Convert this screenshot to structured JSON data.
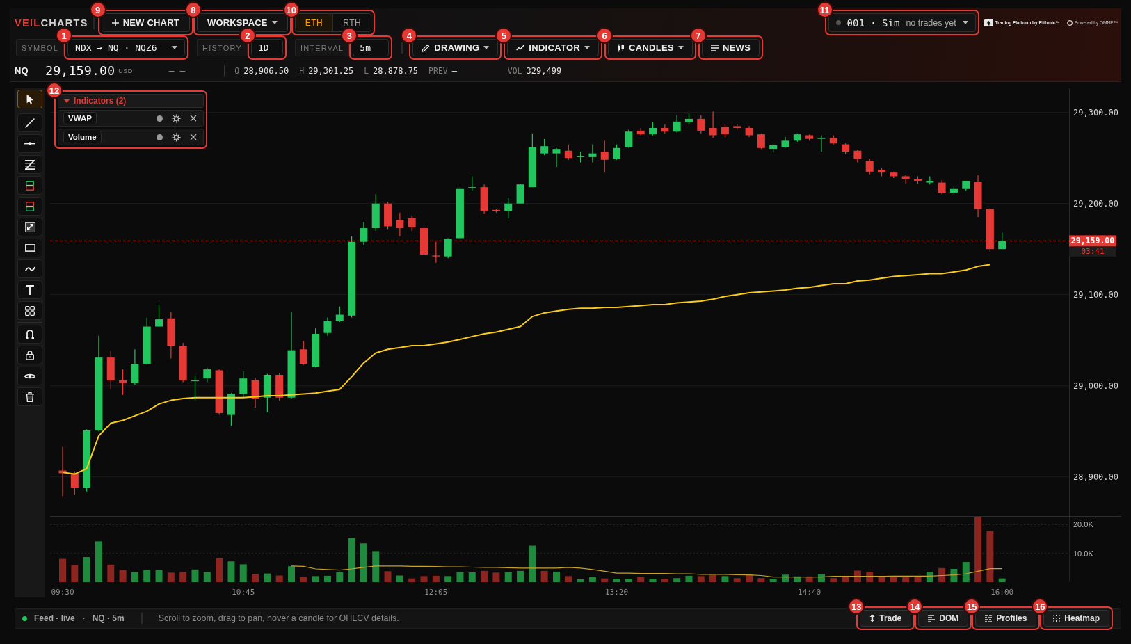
{
  "header": {
    "brand": {
      "accent": "VEIL",
      "text": "CHARTS"
    },
    "new_chart": {
      "label": "NEW CHART",
      "callout": "9"
    },
    "workspace": {
      "label": "WORKSPACE",
      "callout": "8"
    },
    "session": {
      "callout": "10",
      "options": [
        {
          "label": "ETH",
          "selected": true
        },
        {
          "label": "RTH",
          "selected": false
        }
      ]
    },
    "account": {
      "id": "001 · Sim",
      "note": "no trades yet",
      "callout": "11"
    },
    "credits": [
      {
        "kind": "arrow",
        "text": "Trading Platform by Rithmic™"
      },
      {
        "kind": "ring",
        "text": "Powered by OMNE™"
      }
    ]
  },
  "toolbar": {
    "symbol": {
      "label": "SYMBOL",
      "value": "NDX → NQ · NQZ6",
      "callout": "1"
    },
    "history": {
      "label": "HISTORY",
      "value": "1D",
      "callout": "2"
    },
    "interval": {
      "label": "INTERVAL",
      "value": "5m",
      "callout": "3"
    },
    "menus": [
      {
        "kind": "pencil",
        "label": "DRAWING",
        "dropdown": true,
        "callout": "4"
      },
      {
        "kind": "indicator",
        "label": "INDICATOR",
        "dropdown": true,
        "callout": "5"
      },
      {
        "kind": "candles",
        "label": "CANDLES",
        "dropdown": true,
        "callout": "6"
      },
      {
        "kind": "news",
        "label": "NEWS",
        "dropdown": false,
        "callout": "7"
      }
    ]
  },
  "quote": {
    "symbol": "NQ",
    "last": "29,159.00",
    "currency": "USD",
    "change": "– –",
    "stats": [
      {
        "label": "O",
        "value": "28,906.50"
      },
      {
        "label": "H",
        "value": "29,301.25"
      },
      {
        "label": "L",
        "value": "28,878.75"
      },
      {
        "label": "PREV",
        "value": "–"
      },
      {
        "label": "VOL",
        "value": "329,499"
      }
    ]
  },
  "tool_groups": [
    [
      {
        "kind": "select",
        "selected": true
      }
    ],
    [
      {
        "kind": "trendline",
        "selected": false
      },
      {
        "kind": "hline",
        "selected": false
      },
      {
        "kind": "channel",
        "selected": false
      },
      {
        "kind": "long",
        "selected": false
      },
      {
        "kind": "short",
        "selected": false
      },
      {
        "kind": "measure",
        "selected": false
      },
      {
        "kind": "rectangle",
        "selected": false
      },
      {
        "kind": "brush",
        "selected": false
      },
      {
        "kind": "text",
        "selected": false
      },
      {
        "kind": "pattern",
        "selected": false
      }
    ],
    [
      {
        "kind": "magnet",
        "selected": false
      },
      {
        "kind": "lock",
        "selected": false
      },
      {
        "kind": "eye",
        "selected": false
      },
      {
        "kind": "trash",
        "selected": false
      }
    ]
  ],
  "indicators_panel": {
    "title": "Indicators (2)",
    "expanded": true,
    "callout": "12",
    "items": [
      {
        "name": "VWAP"
      },
      {
        "name": "Volume"
      }
    ]
  },
  "price_chart": {
    "chart_data": {
      "type": "candlestick",
      "grid": true,
      "ylim": [
        28857,
        29326.5
      ],
      "yticks": [
        {
          "value": 28900,
          "label": "28,900.00"
        },
        {
          "value": 29000,
          "label": "29,000.00"
        },
        {
          "value": 29100,
          "label": "29,100.00"
        },
        {
          "value": 29200,
          "label": "29,200.00"
        },
        {
          "value": 29300,
          "label": "29,300.00"
        }
      ],
      "categories": [
        null,
        null,
        null,
        null,
        null,
        null,
        null,
        null,
        null,
        null,
        null,
        null,
        null,
        null,
        null,
        null,
        null,
        null,
        null,
        null,
        null,
        null,
        null,
        null,
        null,
        null,
        null,
        null,
        null,
        null,
        null,
        null,
        null,
        null,
        null,
        null,
        null,
        null,
        null,
        null,
        null,
        null,
        null,
        null,
        null,
        null,
        null,
        null,
        null,
        null,
        null,
        null,
        null,
        null,
        null,
        null,
        null,
        null,
        null,
        null,
        null,
        null,
        null,
        null,
        null,
        null,
        null,
        null,
        null,
        null,
        null,
        null,
        null,
        null,
        null,
        null,
        null,
        null,
        null
      ],
      "ohlc": [
        [
          28907,
          28933,
          28879,
          28904
        ],
        [
          28904,
          28906,
          28880,
          28888
        ],
        [
          28888,
          28952,
          28884,
          28951
        ],
        [
          28951,
          29055,
          28950,
          29031
        ],
        [
          29031,
          29038,
          28996,
          29006
        ],
        [
          29006,
          29018,
          28990,
          29003
        ],
        [
          29003,
          29040,
          29001,
          29024
        ],
        [
          29024,
          29075,
          29023,
          29065
        ],
        [
          29065,
          29089,
          29065,
          29073
        ],
        [
          29074,
          29081,
          29030,
          29044
        ],
        [
          29044,
          29047,
          29004,
          29006
        ],
        [
          29005,
          29011,
          28984,
          29006
        ],
        [
          29008,
          29020,
          29004,
          29018
        ],
        [
          29017,
          29018,
          28968,
          28970
        ],
        [
          28968,
          28992,
          28956,
          28991
        ],
        [
          28991,
          29016,
          28987,
          29008
        ],
        [
          29006,
          29009,
          28976,
          28986
        ],
        [
          28987,
          29013,
          28971,
          29012
        ],
        [
          29012,
          29014,
          28984,
          28987
        ],
        [
          28987,
          29081,
          28986,
          29039
        ],
        [
          29040,
          29049,
          29023,
          29024
        ],
        [
          29021,
          29063,
          29020,
          29057
        ],
        [
          29058,
          29075,
          29055,
          29071
        ],
        [
          29071,
          29087,
          29070,
          29078
        ],
        [
          29077,
          29164,
          29075,
          29158
        ],
        [
          29158,
          29180,
          29154,
          29173
        ],
        [
          29173,
          29210,
          29170,
          29200
        ],
        [
          29200,
          29202,
          29172,
          29175
        ],
        [
          29182,
          29190,
          29164,
          29173
        ],
        [
          29184,
          29187,
          29170,
          29174
        ],
        [
          29173,
          29174,
          29143,
          29144
        ],
        [
          29143,
          29158,
          29135,
          29142
        ],
        [
          29142,
          29162,
          29140,
          29161
        ],
        [
          29162,
          29218,
          29161,
          29216
        ],
        [
          29217,
          29230,
          29214,
          29218
        ],
        [
          29218,
          29221,
          29189,
          29192
        ],
        [
          29193,
          29194,
          29190,
          29192
        ],
        [
          29192,
          29206,
          29184,
          29200
        ],
        [
          29200,
          29222,
          29200,
          29221
        ],
        [
          29218,
          29277,
          29218,
          29262
        ],
        [
          29255,
          29271,
          29253,
          29263
        ],
        [
          29255,
          29261,
          29240,
          29260
        ],
        [
          29258,
          29265,
          29248,
          29250
        ],
        [
          29251,
          29257,
          29245,
          29252
        ],
        [
          29251,
          29265,
          29245,
          29255
        ],
        [
          29257,
          29269,
          29234,
          29248
        ],
        [
          29249,
          29265,
          29248,
          29261
        ],
        [
          29262,
          29281,
          29261,
          29279
        ],
        [
          29280,
          29283,
          29275,
          29276
        ],
        [
          29276,
          29289,
          29275,
          29283
        ],
        [
          29283,
          29287,
          29277,
          29279
        ],
        [
          29279,
          29297,
          29278,
          29290
        ],
        [
          29289,
          29299,
          29287,
          29293
        ],
        [
          29293,
          29297,
          29277,
          29280
        ],
        [
          29283,
          29301,
          29272,
          29275
        ],
        [
          29284,
          29287,
          29273,
          29276
        ],
        [
          29285,
          29287,
          29281,
          29283
        ],
        [
          29283,
          29285,
          29273,
          29275
        ],
        [
          29276,
          29277,
          29260,
          29261
        ],
        [
          29260,
          29265,
          29256,
          29264
        ],
        [
          29262,
          29273,
          29261,
          29269
        ],
        [
          29269,
          29277,
          29268,
          29276
        ],
        [
          29275,
          29276,
          29269,
          29271
        ],
        [
          29272,
          29275,
          29257,
          29272
        ],
        [
          29272,
          29275,
          29265,
          29266
        ],
        [
          29265,
          29266,
          29254,
          29257
        ],
        [
          29258,
          29259,
          29245,
          29249
        ],
        [
          29247,
          29249,
          29232,
          29235
        ],
        [
          29237,
          29239,
          29230,
          29234
        ],
        [
          29234,
          29235,
          29228,
          29230
        ],
        [
          29230,
          29231,
          29222,
          29227
        ],
        [
          29227,
          29230,
          29222,
          29225
        ],
        [
          29223,
          29230,
          29221,
          29225
        ],
        [
          29223,
          29226,
          29210,
          29212
        ],
        [
          29212,
          29219,
          29210,
          29216
        ],
        [
          29216,
          29225,
          29214,
          29225
        ],
        [
          29224,
          29231,
          29185,
          29194
        ],
        [
          29194,
          29195,
          29147,
          29150
        ],
        [
          29150,
          29168,
          29150,
          29159
        ]
      ],
      "series": [
        {
          "type": "line",
          "color": "#facc15",
          "values": [
            28905,
            28903,
            28909,
            28945,
            28959,
            28962,
            28967,
            28972,
            28980,
            28984,
            28986,
            28987,
            28987,
            28987,
            28987,
            28987,
            28988,
            28989,
            28989,
            28990,
            28991,
            28992,
            28994,
            28996,
            29010,
            29025,
            29036,
            29040,
            29042,
            29044,
            29044,
            29046,
            29048,
            29051,
            29054,
            29057,
            29059,
            29062,
            29065,
            29076,
            29080,
            29082,
            29084,
            29085,
            29085,
            29086,
            29086,
            29087,
            29088,
            29089,
            29089,
            29091,
            29092,
            29093,
            29095,
            29098,
            29100,
            29102,
            29103,
            29104,
            29105,
            29107,
            29108,
            29110,
            29112,
            29112,
            29115,
            29116,
            29118,
            29120,
            29121,
            29122,
            29123,
            29123,
            29125,
            29127,
            29131,
            29133,
            null
          ]
        }
      ],
      "ref_lines": [
        {
          "axis": "y",
          "value": 29159
        }
      ],
      "annotations": [
        "29,159.00",
        "03:41"
      ]
    }
  },
  "volume_chart": {
    "chart_data": {
      "type": "bar",
      "grid": true,
      "ylim": [
        0,
        23000
      ],
      "yticks": [
        {
          "value": 10000,
          "label": "10.0K"
        },
        {
          "value": 20000,
          "label": "20.0K"
        }
      ],
      "categories": [
        "09:30",
        null,
        null,
        null,
        null,
        null,
        null,
        null,
        null,
        null,
        null,
        null,
        null,
        null,
        null,
        "10:45",
        null,
        null,
        null,
        null,
        null,
        null,
        null,
        null,
        null,
        null,
        null,
        null,
        null,
        null,
        null,
        "12:05",
        null,
        null,
        null,
        null,
        null,
        null,
        null,
        null,
        null,
        null,
        null,
        null,
        null,
        null,
        "13:20",
        null,
        null,
        null,
        null,
        null,
        null,
        null,
        null,
        null,
        null,
        null,
        null,
        null,
        null,
        null,
        "14:40",
        null,
        null,
        null,
        null,
        null,
        null,
        null,
        null,
        null,
        null,
        null,
        null,
        null,
        null,
        null,
        "16:00"
      ],
      "series": [
        {
          "color": "#1f8a3d",
          "values": [
            null,
            null,
            8700,
            14200,
            null,
            null,
            3500,
            4200,
            4200,
            null,
            null,
            4400,
            3500,
            null,
            7200,
            6200,
            null,
            3000,
            null,
            5500,
            null,
            2100,
            2200,
            3500,
            15300,
            13500,
            10800,
            null,
            2300,
            null,
            null,
            null,
            2100,
            3500,
            3400,
            null,
            null,
            3500,
            3900,
            12700,
            null,
            3600,
            null,
            1000,
            1700,
            null,
            1200,
            1200,
            null,
            1200,
            null,
            1400,
            2200,
            null,
            null,
            2100,
            null,
            null,
            null,
            1200,
            2600,
            2000,
            null,
            2900,
            null,
            null,
            null,
            null,
            null,
            null,
            null,
            null,
            3600,
            null,
            4600,
            7000,
            null,
            null,
            1300
          ]
        },
        {
          "color": "#8c2420",
          "values": [
            8100,
            6000,
            null,
            null,
            6100,
            4200,
            null,
            null,
            null,
            3300,
            3500,
            null,
            null,
            8300,
            null,
            null,
            2900,
            null,
            2300,
            null,
            1800,
            null,
            null,
            null,
            null,
            null,
            null,
            3800,
            null,
            1300,
            2100,
            2200,
            null,
            null,
            null,
            3900,
            3300,
            null,
            null,
            null,
            3900,
            null,
            2100,
            null,
            null,
            1300,
            null,
            null,
            1800,
            null,
            1200,
            null,
            null,
            2100,
            2500,
            null,
            1400,
            2600,
            1400,
            null,
            null,
            null,
            2000,
            null,
            1400,
            2000,
            4000,
            3600,
            2100,
            1700,
            1700,
            2000,
            null,
            4900,
            null,
            null,
            22600,
            17800,
            null
          ]
        },
        {
          "type": "line",
          "color": "#c9a227",
          "values": [
            null,
            null,
            null,
            null,
            null,
            null,
            null,
            null,
            null,
            null,
            null,
            null,
            null,
            null,
            null,
            null,
            null,
            null,
            null,
            5600,
            5500,
            4600,
            4400,
            4200,
            4600,
            5100,
            5600,
            5600,
            5600,
            5500,
            5500,
            5400,
            5300,
            5300,
            5200,
            5100,
            5100,
            5000,
            4900,
            4900,
            4900,
            4900,
            5100,
            4900,
            4400,
            3800,
            3100,
            3100,
            3000,
            3000,
            3000,
            2900,
            2900,
            2700,
            2700,
            2700,
            2600,
            2500,
            2300,
            1800,
            1800,
            1800,
            1800,
            1800,
            2000,
            2000,
            2000,
            2000,
            2000,
            2100,
            2100,
            2100,
            2100,
            2300,
            2500,
            2900,
            3800,
            4700,
            4700
          ]
        }
      ]
    }
  },
  "status_bar": {
    "live": true,
    "feed": "Feed · live",
    "separator": "·",
    "instrument": "NQ · 5m",
    "hint": "Scroll to zoom, drag to pan, hover a candle for OHLCV details.",
    "buttons": [
      {
        "kind": "trade",
        "label": "Trade",
        "callout": "13"
      },
      {
        "kind": "dom",
        "label": "DOM",
        "callout": "14"
      },
      {
        "kind": "profiles",
        "label": "Profiles",
        "callout": "15"
      },
      {
        "kind": "heatmap",
        "label": "Heatmap",
        "callout": "16"
      }
    ]
  }
}
